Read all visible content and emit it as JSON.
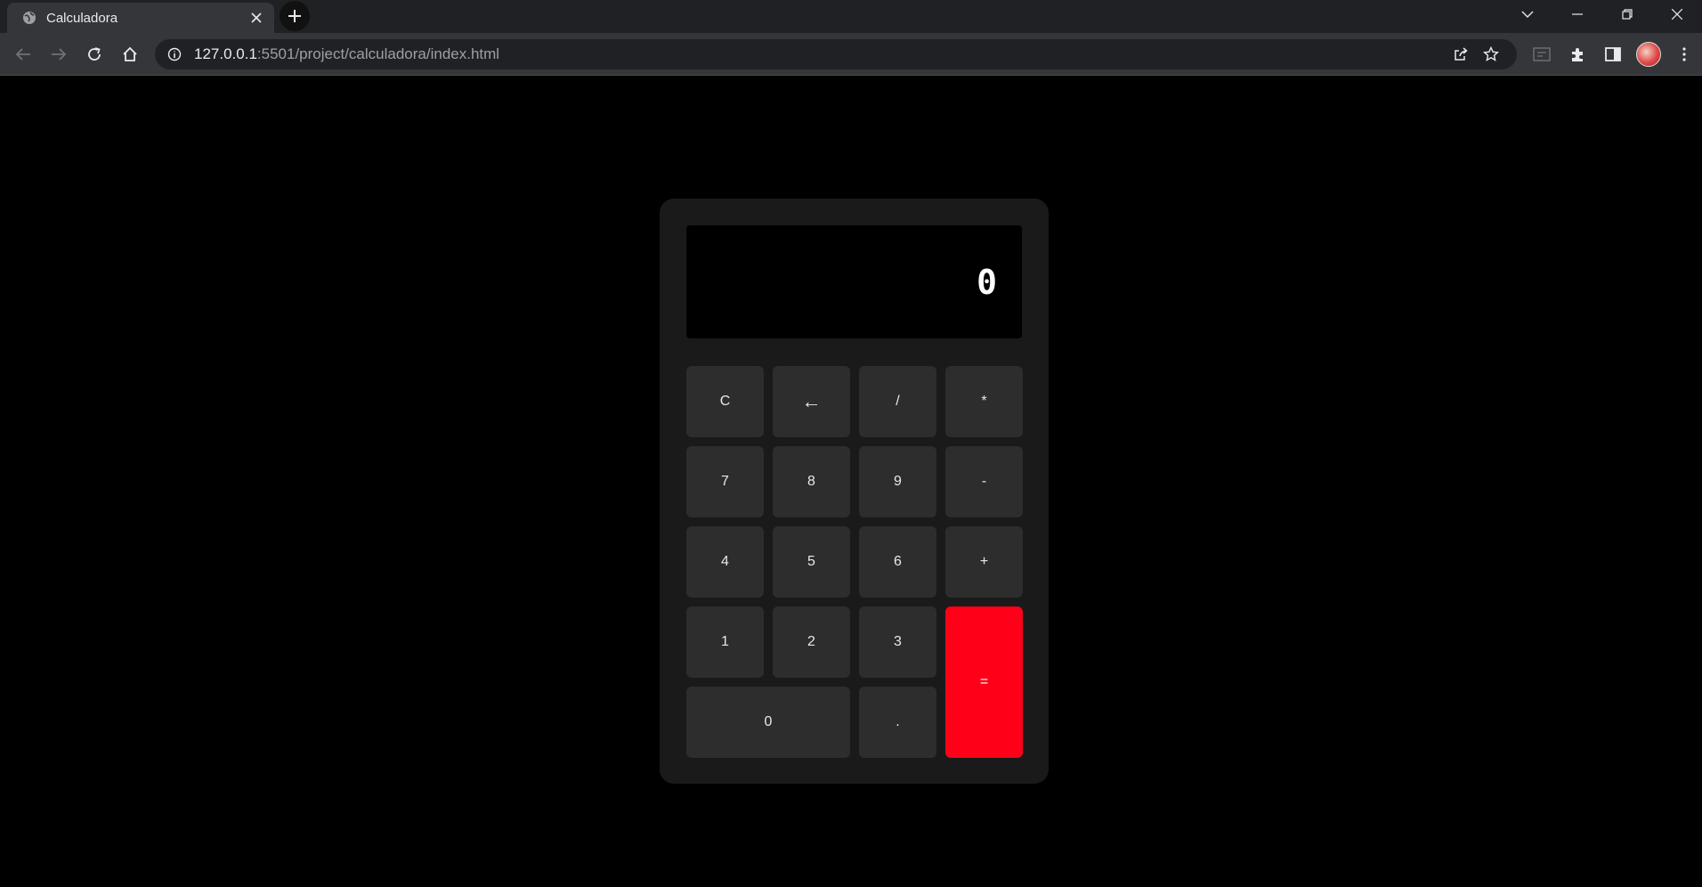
{
  "browser": {
    "tab": {
      "title": "Calculadora"
    },
    "url": {
      "host": "127.0.0.1",
      "rest": ":5501/project/calculadora/index.html"
    }
  },
  "calculator": {
    "display": "0",
    "keys": {
      "clear": "C",
      "backspace": "←",
      "divide": "/",
      "multiply": "*",
      "seven": "7",
      "eight": "8",
      "nine": "9",
      "minus": "-",
      "four": "4",
      "five": "5",
      "six": "6",
      "plus": "+",
      "one": "1",
      "two": "2",
      "three": "3",
      "equals": "=",
      "zero": "0",
      "dot": "."
    },
    "colors": {
      "panel": "#1a1a1a",
      "key": "#2d2d2d",
      "equals": "#ff0019",
      "display": "#000000"
    }
  }
}
